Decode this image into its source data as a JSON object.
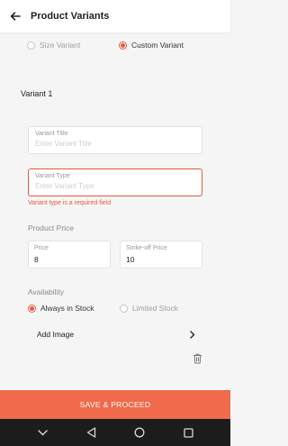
{
  "appbar": {
    "title": "Product Variants"
  },
  "variant_type_choice": {
    "options": [
      {
        "label": "Size Variant",
        "selected": false
      },
      {
        "label": "Custom Variant",
        "selected": true
      }
    ]
  },
  "variant_section": {
    "title": "Variant 1"
  },
  "variant_title_field": {
    "label": "Variant Title",
    "placeholder": "Enter Variant Title"
  },
  "variant_type_field": {
    "label": "Variant Type",
    "placeholder": "Enter Variant Type",
    "error": "Variant type is a required field"
  },
  "product_price": {
    "heading": "Product Price",
    "price": {
      "label": "Price",
      "value": "8"
    },
    "strike_off": {
      "label": "Strike-off Price",
      "value": "10"
    }
  },
  "availability": {
    "heading": "Availability",
    "options": [
      {
        "label": "Always in Stock",
        "selected": true
      },
      {
        "label": "Limited Stock",
        "selected": false
      }
    ]
  },
  "add_image": {
    "label": "Add Image"
  },
  "cta": {
    "label": "SAVE & PROCEED"
  },
  "colors": {
    "accent": "#f06a4b",
    "error": "#e45b3a"
  },
  "icons": [
    "back-arrow-icon",
    "chevron-right-icon",
    "trash-icon",
    "nav-back-icon",
    "nav-home-icon",
    "nav-recents-icon"
  ]
}
